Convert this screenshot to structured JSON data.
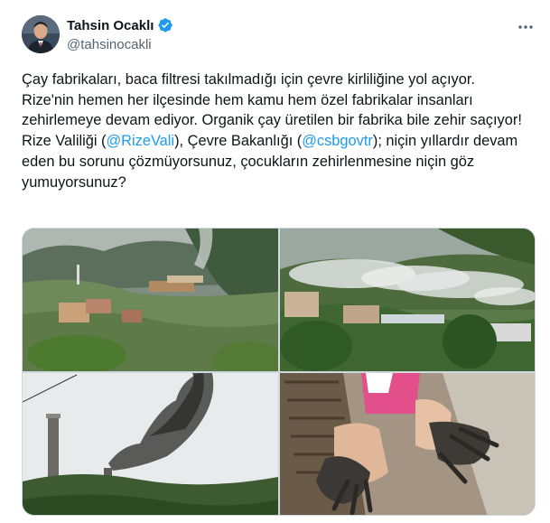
{
  "author": {
    "display_name": "Tahsin Ocaklı",
    "handle": "@tahsinocakli",
    "verified": true,
    "verified_color": "#1d9bf0"
  },
  "tweet": {
    "text_segments": [
      {
        "text": "Çay fabrikaları, baca filtresi takılmadığı için çevre kirliliğine yol açıyor.\nRize'nin hemen her ilçesinde hem kamu hem özel fabrikalar insanları zehirlemeye devam ediyor. Organik çay üretilen bir fabrika bile zehir saçıyor!\nRize Valiliği (",
        "mention": false
      },
      {
        "text": "@RizeVali",
        "mention": true
      },
      {
        "text": "), Çevre Bakanlığı (",
        "mention": false
      },
      {
        "text": "@csbgovtr",
        "mention": true
      },
      {
        "text": "); niçin yıllardır devam eden bu sorunu çözmüyorsunuz, çocukların zehirlenmesine niçin göz yumuyorsunuz?",
        "mention": false
      }
    ]
  },
  "media": {
    "photos": [
      {
        "name": "photo-valley-factory-smoke"
      },
      {
        "name": "photo-white-smoke-hillside"
      },
      {
        "name": "photo-chimney-black-smoke"
      },
      {
        "name": "photo-child-soot-hands"
      }
    ]
  },
  "icons": {
    "more": "more-options-icon",
    "verified": "verified-badge-icon"
  },
  "colors": {
    "text": "#0f1419",
    "secondary": "#536471",
    "link": "#1d9bf0"
  }
}
